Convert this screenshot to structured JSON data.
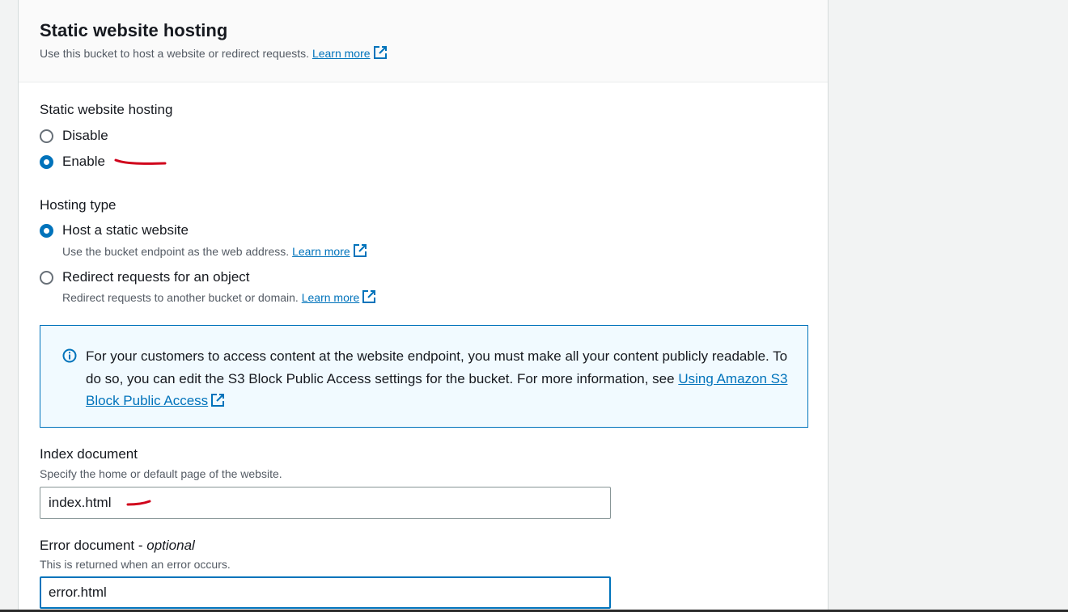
{
  "section": {
    "title": "Static website hosting",
    "description": "Use this bucket to host a website or redirect requests.",
    "learn_more": "Learn more"
  },
  "hosting_toggle": {
    "label": "Static website hosting",
    "options": [
      {
        "label": "Disable",
        "selected": false
      },
      {
        "label": "Enable",
        "selected": true
      }
    ]
  },
  "hosting_type": {
    "label": "Hosting type",
    "options": [
      {
        "label": "Host a static website",
        "description": "Use the bucket endpoint as the web address.",
        "link": "Learn more",
        "selected": true
      },
      {
        "label": "Redirect requests for an object",
        "description": "Redirect requests to another bucket or domain.",
        "link": "Learn more",
        "selected": false
      }
    ]
  },
  "info_alert": {
    "text": "For your customers to access content at the website endpoint, you must make all your content publicly readable. To do so, you can edit the S3 Block Public Access settings for the bucket. For more information, see",
    "link": "Using Amazon S3 Block Public Access"
  },
  "index_document": {
    "label": "Index document",
    "description": "Specify the home or default page of the website.",
    "value": "index.html"
  },
  "error_document": {
    "label": "Error document - ",
    "label_optional": "optional",
    "description": "This is returned when an error occurs.",
    "value": "error.html"
  },
  "colors": {
    "link": "#0073bb",
    "annotation": "#d0021b",
    "info_bg": "#f1faff"
  }
}
